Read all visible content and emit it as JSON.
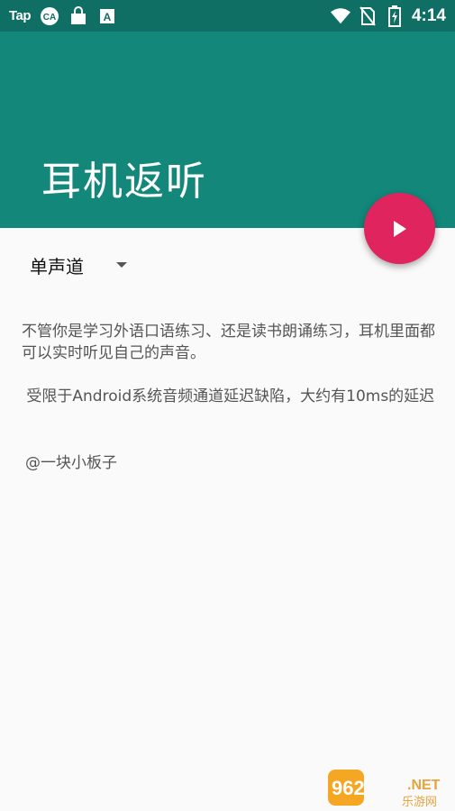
{
  "status_bar": {
    "tap_label": "Tap",
    "time": "4:14",
    "icons": [
      "ca-icon",
      "store-bag-icon",
      "a-app-icon",
      "wifi-icon",
      "no-sim-icon",
      "battery-charging-icon"
    ]
  },
  "app_bar": {
    "title": "耳机返听"
  },
  "fab": {
    "icon": "play-icon"
  },
  "channel_select": {
    "selected": "单声道"
  },
  "description": {
    "para1": "不管你是学习外语口语练习、还是读书朗诵练习，耳机里面都可以实时听见自己的声音。",
    "para2": " 受限于Android系统音频通道延迟缺陷，大约有10ms的延迟",
    "author": "@一块小板子"
  },
  "watermark": {
    "brand": "962",
    "net": ".NET",
    "sub": "乐游网"
  },
  "colors": {
    "status_bar": "#0f6f64",
    "app_bar": "#13877a",
    "fab": "#e0245e",
    "background": "#fafafa"
  }
}
